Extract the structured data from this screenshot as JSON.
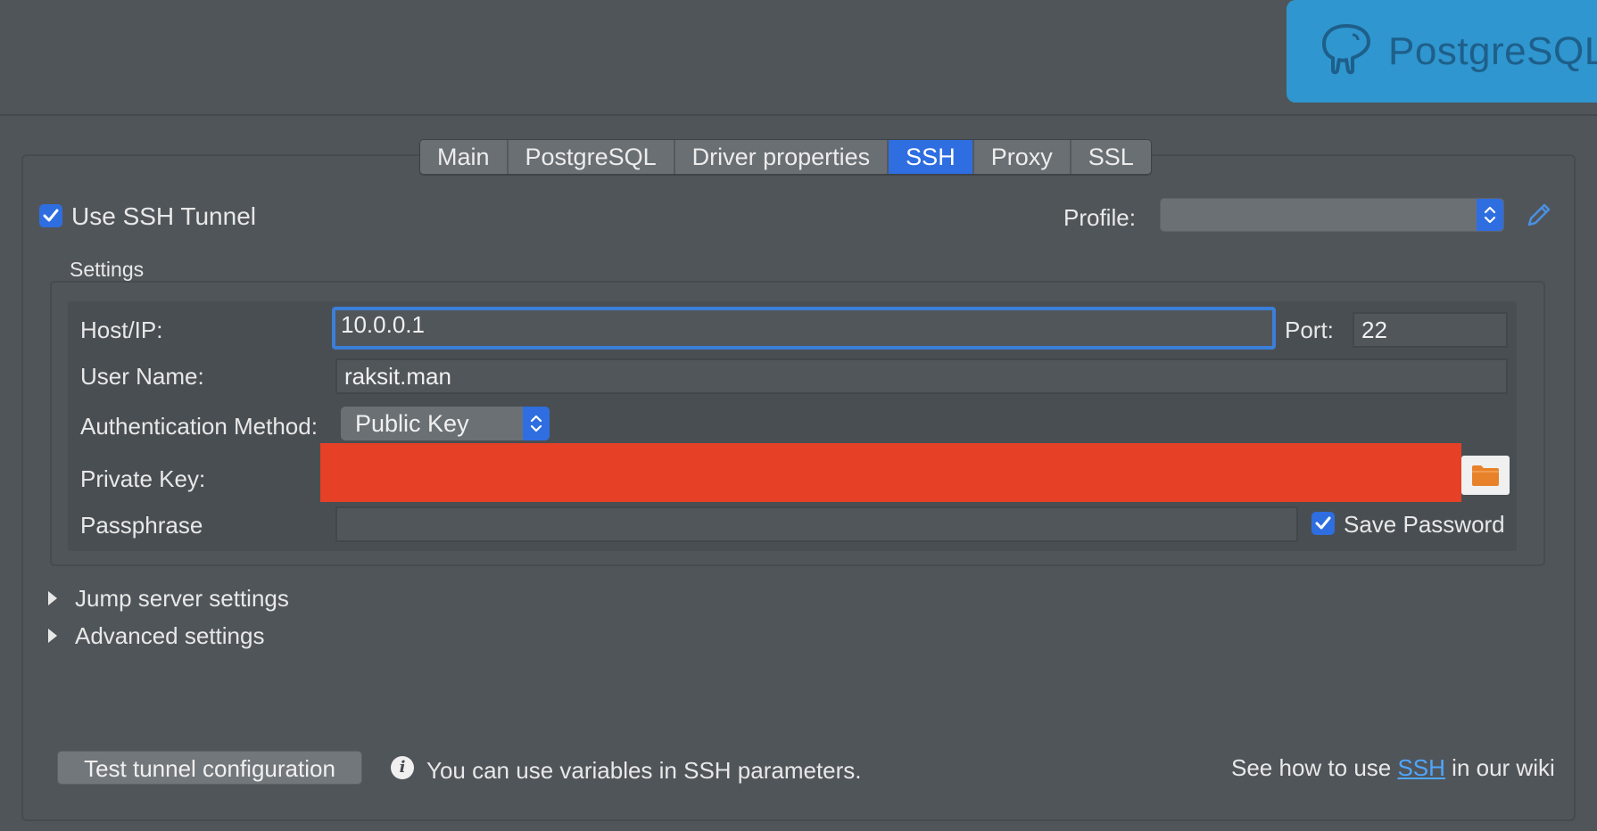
{
  "logo": {
    "text": "PostgreSQL",
    "icon": "elephant-icon"
  },
  "tabs": [
    {
      "label": "Main",
      "active": false
    },
    {
      "label": "PostgreSQL",
      "active": false
    },
    {
      "label": "Driver properties",
      "active": false
    },
    {
      "label": "SSH",
      "active": true
    },
    {
      "label": "Proxy",
      "active": false
    },
    {
      "label": "SSL",
      "active": false
    }
  ],
  "use_ssh_tunnel": {
    "label": "Use SSH Tunnel",
    "checked": true
  },
  "profile": {
    "label": "Profile:",
    "value": ""
  },
  "settings": {
    "title": "Settings",
    "host_label": "Host/IP:",
    "host_value": "10.0.0.1",
    "port_label": "Port:",
    "port_value": "22",
    "user_label": "User Name:",
    "user_value": "raksit.man",
    "auth_label": "Authentication Method:",
    "auth_value": "Public Key",
    "private_key_label": "Private Key:",
    "passphrase_label": "Passphrase",
    "passphrase_value": "",
    "save_password_label": "Save Password",
    "save_password_checked": true
  },
  "sections": {
    "jump": "Jump server settings",
    "advanced": "Advanced settings"
  },
  "footer": {
    "test_button": "Test tunnel configuration",
    "info_text": "You can use variables in SSH parameters.",
    "wiki_prefix": "See how to use ",
    "wiki_link": "SSH",
    "wiki_suffix": " in our wiki"
  },
  "colors": {
    "background": "#50555a",
    "accent": "#2e6ee0",
    "logo_bg": "#2f96cf",
    "redaction": "#e64026",
    "folder": "#e8822a"
  }
}
